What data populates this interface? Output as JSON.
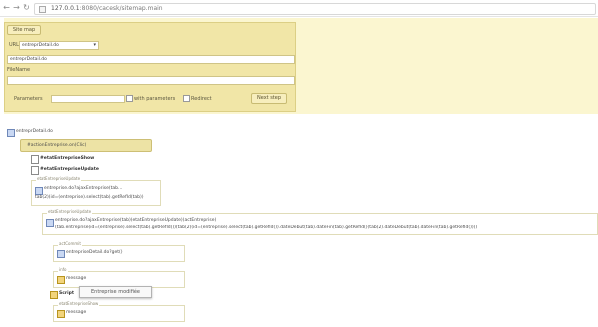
{
  "browser": {
    "url_host": "127.0.0.1",
    "url_path": ":8080/cacesk/sitemap.main"
  },
  "sitemap_panel": {
    "title_button": "Site map",
    "url_label": "URL",
    "url_select_value": "entreprDetail.do",
    "url_input_value": "entreprDetail.do",
    "filename_label": "FileName",
    "parameters_label": "Parameters",
    "opt_with_parameters": "with parameters",
    "opt_redirect": "Redirect",
    "submit_button": "Next step"
  },
  "tree": {
    "root_label": "entreprDetail.do",
    "action_tag": "#actionEntreprise.on(Clic)",
    "node1": "#etatEntrepriseShow",
    "node2": "#etatEntrepriseUpdate",
    "box1_legend": "etatEntrepriseUpdate",
    "box1_line1": "entreprise.do?ajaxEntreprise(tab...",
    "box1_line2": "tab(2)(id=(entreprise).select(tab).getRefId(tab))",
    "box2_legend": "etatEntrepriseUpdate",
    "box2_line1": "entreprise.do?ajaxEntreprise(tab)(etatEntrepriseUpdate)(actEntreprise)",
    "box2_line2": "(tab.entreprise(id=(entreprise).select(tab).getRefId())(tab(2)(id=(entreprise).select(tab).getRefId()).dateDebut(tab).dateFin(tab).getRefId()(tab(2).dateDebut(tab).dateFin(tab).getRefId())))",
    "box3_legend": "actCommit",
    "box3_line": "entrepriseDetail.do?get()",
    "box4_legend": "info",
    "box4_line": "message",
    "node3": "Script",
    "tooltip": "Entreprise modifiée",
    "box5_legend": "etatEntrepriseShow",
    "box5_line": "message"
  }
}
